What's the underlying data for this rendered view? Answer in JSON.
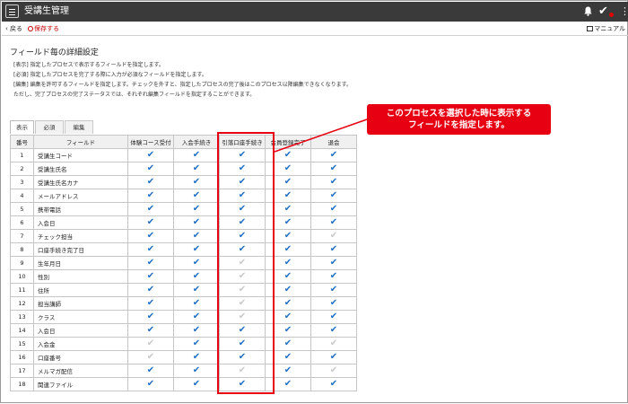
{
  "header": {
    "title": "受講生管理",
    "notification_icon": "bell-icon",
    "check_icon": "checkmark-icon",
    "more_icon": "kebab-icon"
  },
  "subnav": {
    "back_label": "戻る",
    "save_label": "保存する",
    "manual_label": "マニュアル"
  },
  "section": {
    "title": "フィールド毎の詳細設定",
    "descriptions": [
      "[表示] 指定したプロセスで表示するフィールドを指定します。",
      "[必須] 指定したプロセスを完了する際に入力が必須なフィールドを指定します。",
      "[編集] 編集を許可するフィールドを指定します。チェックを外すと、指定したプロセスの完了後はこのプロセス以降編集できなくなります。",
      "ただし、完了プロセスの完了ステータスでは、それぞれ編集フィールドを指定することができます。"
    ]
  },
  "tabs": [
    {
      "label": "表示",
      "active": true
    },
    {
      "label": "必須",
      "active": false
    },
    {
      "label": "編集",
      "active": false
    }
  ],
  "table": {
    "headers": [
      "番号",
      "フィールド",
      "体験コース受付",
      "入会手続き",
      "引落口座手続き",
      "会員登録完了",
      "退会"
    ],
    "check_glyph": "✔",
    "rows": [
      {
        "no": "1",
        "field": "受講生コード",
        "checks": [
          1,
          1,
          1,
          1,
          1
        ]
      },
      {
        "no": "2",
        "field": "受講生氏名",
        "checks": [
          1,
          1,
          1,
          1,
          1
        ]
      },
      {
        "no": "3",
        "field": "受講生氏名カナ",
        "checks": [
          1,
          1,
          1,
          1,
          1
        ]
      },
      {
        "no": "4",
        "field": "メールアドレス",
        "checks": [
          1,
          1,
          1,
          1,
          1
        ]
      },
      {
        "no": "5",
        "field": "携帯電話",
        "checks": [
          1,
          1,
          1,
          1,
          1
        ]
      },
      {
        "no": "6",
        "field": "入会日",
        "checks": [
          1,
          1,
          1,
          1,
          1
        ]
      },
      {
        "no": "7",
        "field": "チェック担当",
        "checks": [
          1,
          1,
          1,
          1,
          0
        ]
      },
      {
        "no": "8",
        "field": "口座手続き完了日",
        "checks": [
          1,
          1,
          1,
          1,
          1
        ]
      },
      {
        "no": "9",
        "field": "生年月日",
        "checks": [
          1,
          1,
          0,
          1,
          1
        ]
      },
      {
        "no": "10",
        "field": "性別",
        "checks": [
          1,
          1,
          0,
          1,
          1
        ]
      },
      {
        "no": "11",
        "field": "住所",
        "checks": [
          1,
          1,
          0,
          1,
          1
        ]
      },
      {
        "no": "12",
        "field": "担当講師",
        "checks": [
          1,
          1,
          0,
          1,
          1
        ]
      },
      {
        "no": "13",
        "field": "クラス",
        "checks": [
          1,
          1,
          0,
          1,
          1
        ]
      },
      {
        "no": "14",
        "field": "入会日",
        "checks": [
          1,
          1,
          1,
          1,
          1
        ]
      },
      {
        "no": "15",
        "field": "入会金",
        "checks": [
          0,
          1,
          1,
          1,
          0
        ]
      },
      {
        "no": "16",
        "field": "口座番号",
        "checks": [
          0,
          1,
          1,
          1,
          1
        ]
      },
      {
        "no": "17",
        "field": "メルマガ配信",
        "checks": [
          1,
          1,
          0,
          1,
          0
        ]
      },
      {
        "no": "18",
        "field": "関連ファイル",
        "checks": [
          1,
          1,
          1,
          1,
          1
        ]
      }
    ]
  },
  "callout": {
    "line1": "このプロセスを選択した時に表示する",
    "line2": "フィールドを指定します。"
  },
  "colors": {
    "topbar": "#3a3a3a",
    "check_on": "#1f6fc4",
    "check_off": "#c8c8c8",
    "highlight": "#e60012"
  }
}
